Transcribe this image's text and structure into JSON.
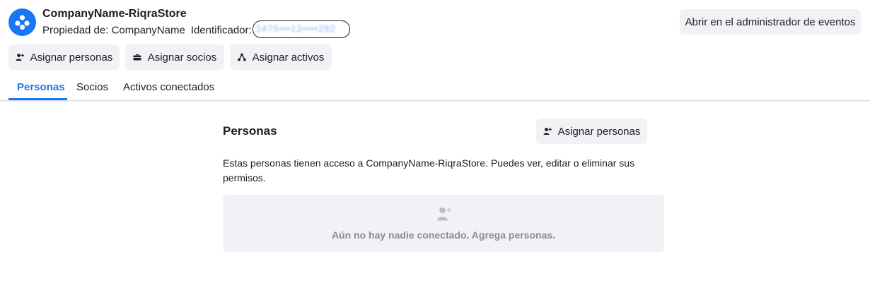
{
  "header": {
    "company_name": "CompanyName-RiqraStore",
    "owner_label": "Propiedad de: CompanyName",
    "identifier_label": "Identificador:",
    "identifier_value": "1475•••12••••292",
    "events_button_label": "Abrir en el administrador de eventos"
  },
  "actions": {
    "assign_people_label": "Asignar personas",
    "assign_partners_label": "Asignar socios",
    "assign_assets_label": "Asignar activos"
  },
  "tabs": [
    {
      "label": "Personas",
      "active": true
    },
    {
      "label": "Socios",
      "active": false
    },
    {
      "label": "Activos conectados",
      "active": false
    }
  ],
  "section": {
    "title": "Personas",
    "assign_button_label": "Asignar personas",
    "description": "Estas personas tienen acceso a CompanyName-RiqraStore. Puedes ver, editar o eliminar sus permisos.",
    "empty_message": "Aún no hay nadie conectado. Agrega personas."
  },
  "colors": {
    "accent": "#1877f2",
    "button_bg": "#f0f2f5",
    "muted_text": "#8a8d91"
  },
  "icons": {
    "avatar": "people-group-icon",
    "assign_people": "person-add-icon",
    "assign_partners": "briefcase-icon",
    "assign_assets": "network-icon",
    "empty_state": "person-add-icon"
  }
}
